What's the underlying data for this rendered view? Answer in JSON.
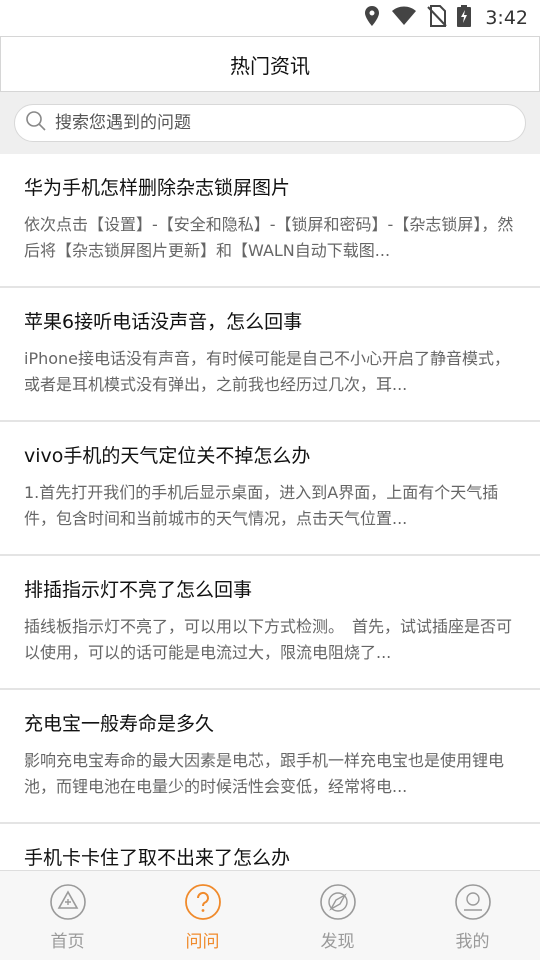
{
  "status_bar": {
    "time": "3:42"
  },
  "header": {
    "title": "热门资讯"
  },
  "search": {
    "placeholder": "搜索您遇到的问题"
  },
  "articles": [
    {
      "question": "华为手机怎样删除杂志锁屏图片",
      "answer": "依次点击【设置】-【安全和隐私】-【锁屏和密码】-【杂志锁屏】，然后将【杂志锁屏图片更新】和【WALN自动下载图..."
    },
    {
      "question": "苹果6接听电话没声音，怎么回事",
      "answer": "iPhone接电话没有声音，有时候可能是自己不小心开启了静音模式，或者是耳机模式没有弹出，之前我也经历过几次，耳..."
    },
    {
      "question": "vivo手机的天气定位关不掉怎么办",
      "answer": "1.首先打开我们的手机后显示桌面，进入到A界面，上面有个天气插件，包含时间和当前城市的天气情况，点击天气位置..."
    },
    {
      "question": "排插指示灯不亮了怎么回事",
      "answer": "插线板指示灯不亮了，可以用以下方式检测。　首先，试试插座是否可以使用，可以的话可能是电流过大，限流电阻烧了..."
    },
    {
      "question": "充电宝一般寿命是多久",
      "answer": "影响充电宝寿命的最大因素是电芯，跟手机一样充电宝也是使用锂电池，而锂电池在电量少的时候活性会变低，经常将电..."
    },
    {
      "question": "手机卡卡住了取不出来了怎么办",
      "answer": ""
    }
  ],
  "tabs": [
    {
      "label": "首页",
      "icon": "home-triangle-icon",
      "active": false
    },
    {
      "label": "问问",
      "icon": "question-icon",
      "active": true
    },
    {
      "label": "发现",
      "icon": "compass-icon",
      "active": false
    },
    {
      "label": "我的",
      "icon": "profile-icon",
      "active": false
    }
  ],
  "colors": {
    "accent": "#f08a2b",
    "inactive": "#9a9a9a",
    "divider": "#e4e4e4",
    "search_bg": "#efefef"
  }
}
